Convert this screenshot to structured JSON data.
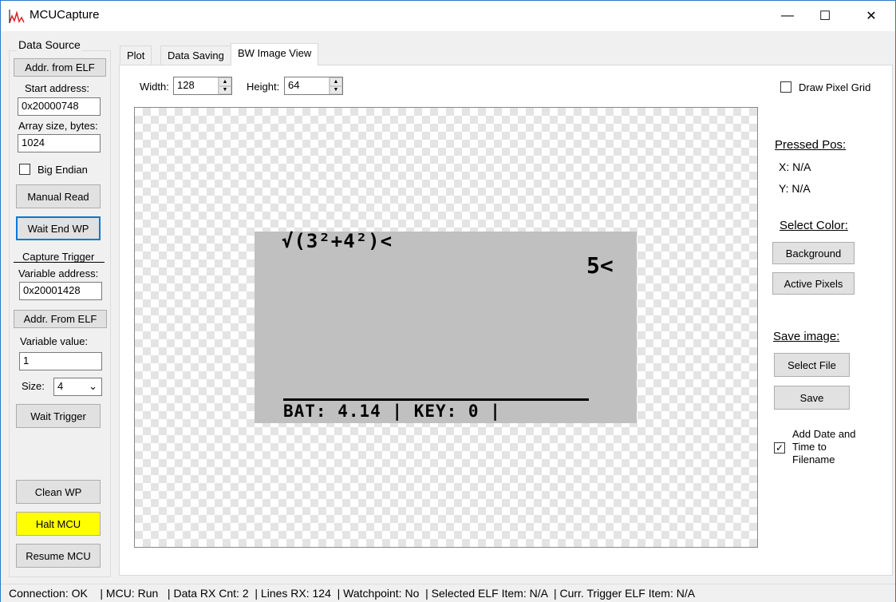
{
  "window": {
    "title": "MCUCapture",
    "minimize": "—",
    "maximize": "☐",
    "close": "✕"
  },
  "left": {
    "group_title": "Data Source",
    "addr_from_elf": "Addr. from ELF",
    "start_address_label": "Start address:",
    "start_address": "0x20000748",
    "array_size_label": "Array size, bytes:",
    "array_size": "1024",
    "big_endian_label": "Big Endian",
    "big_endian": false,
    "manual_read": "Manual Read",
    "wait_end_wp": "Wait End WP",
    "capture_trigger_title": "Capture Trigger",
    "variable_address_label": "Variable address:",
    "variable_address": "0x20001428",
    "addr_from_elf2": "Addr. From ELF",
    "variable_value_label": "Variable value:",
    "variable_value": "1",
    "size_label": "Size:",
    "size_value": "4",
    "wait_trigger": "Wait Trigger",
    "clean_wp": "Clean WP",
    "halt_mcu": "Halt MCU",
    "halt_color": "#ffff00",
    "resume_mcu": "Resume MCU"
  },
  "tabs": [
    {
      "label": "Plot"
    },
    {
      "label": "Data Saving"
    },
    {
      "label": "BW Image View",
      "active": true
    }
  ],
  "image_view": {
    "width_label": "Width:",
    "width": "128",
    "height_label": "Height:",
    "height": "64",
    "draw_grid_label": "Draw Pixel Grid",
    "draw_grid": false,
    "lcd": {
      "line1": "√(3²+4²)<",
      "result": "5<",
      "status": "BAT: 4.14 | KEY: 0 |"
    },
    "pressed_pos_title": "Pressed Pos:",
    "x": "X: N/A",
    "y": "Y: N/A",
    "select_color_title": "Select Color:",
    "background": "Background",
    "active_pixels": "Active Pixels",
    "save_image_title": "Save image:",
    "select_file": "Select  File",
    "save": "Save",
    "add_date_label": "Add Date and Time to Filename",
    "add_date": true
  },
  "status": {
    "text": "Connection: OK    | MCU: Run   | Data RX Cnt: 2  | Lines RX: 124  | Watchpoint: No  | Selected ELF Item: N/A  | Curr. Trigger ELF Item: N/A"
  }
}
